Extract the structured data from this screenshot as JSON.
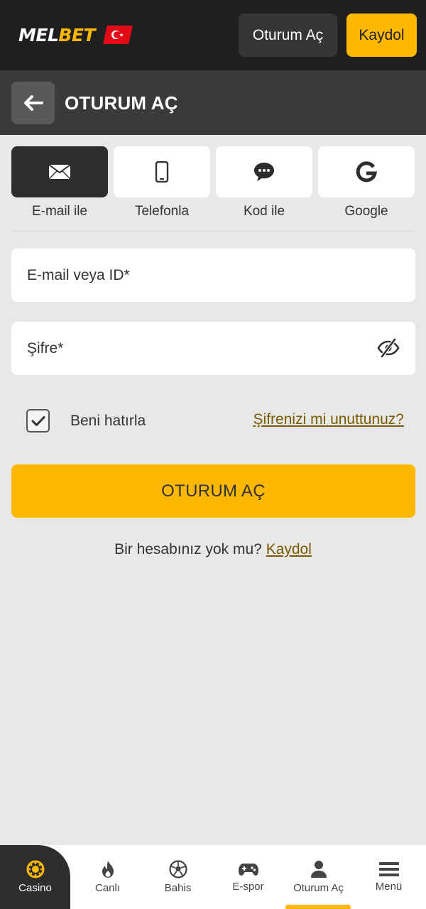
{
  "header": {
    "logo_part1": "MEL",
    "logo_part2": "BET",
    "login_label": "Oturum Aç",
    "register_label": "Kaydol"
  },
  "subheader": {
    "title": "OTURUM AÇ"
  },
  "methods": [
    {
      "label": "E-mail ile",
      "icon": "envelope-icon",
      "active": true
    },
    {
      "label": "Telefonla",
      "icon": "phone-icon",
      "active": false
    },
    {
      "label": "Kod ile",
      "icon": "chat-icon",
      "active": false
    },
    {
      "label": "Google",
      "icon": "google-icon",
      "active": false
    }
  ],
  "form": {
    "email_placeholder": "E-mail veya ID*",
    "email_value": "",
    "password_placeholder": "Şifre*",
    "password_value": "",
    "remember_label": "Beni hatırla",
    "remember_checked": true,
    "forgot_label": "Şifrenizi mi unuttunuz?",
    "submit_label": "OTURUM AÇ",
    "no_account_text": "Bir hesabınız yok mu?",
    "register_link": "Kaydol"
  },
  "bottom_nav": [
    {
      "label": "Casino",
      "icon": "casino-chip-icon",
      "active": true
    },
    {
      "label": "Canlı",
      "icon": "flame-icon",
      "active": false
    },
    {
      "label": "Bahis",
      "icon": "soccer-ball-icon",
      "active": false
    },
    {
      "label": "E-spor",
      "icon": "gamepad-icon",
      "active": false
    },
    {
      "label": "Oturum Aç",
      "icon": "user-icon",
      "active": false
    },
    {
      "label": "Menü",
      "icon": "menu-icon",
      "active": false
    }
  ],
  "colors": {
    "accent": "#ffb800",
    "dark": "#1f1f1f",
    "link": "#7a5a00"
  }
}
